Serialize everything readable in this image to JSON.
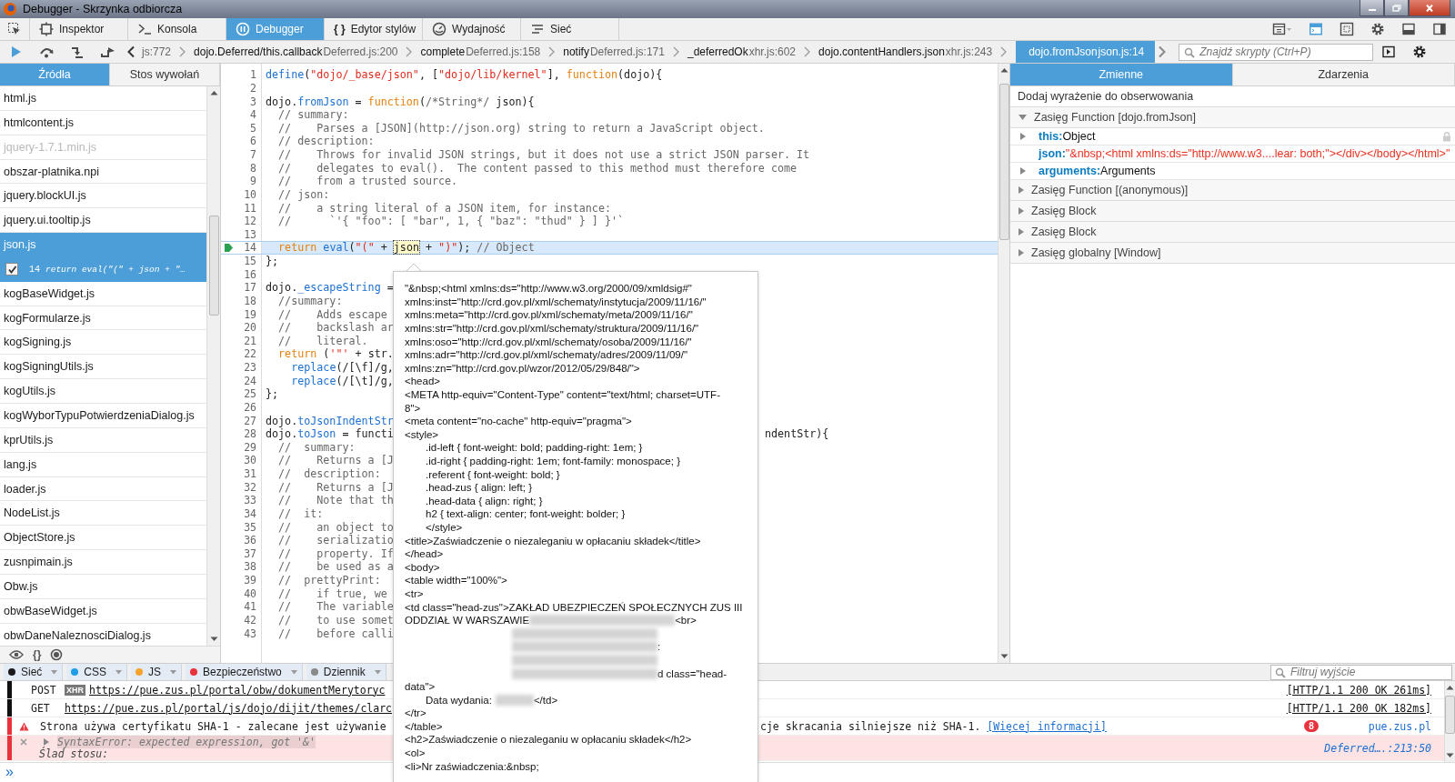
{
  "window": {
    "title": "Debugger - Skrzynka odbiorcza"
  },
  "toolbox_tabs": [
    {
      "label": "Inspektor",
      "kind": "inspector",
      "selected": false
    },
    {
      "label": "Konsola",
      "kind": "console",
      "selected": false
    },
    {
      "label": "Debugger",
      "kind": "pause",
      "selected": true
    },
    {
      "label": "Edytor stylów",
      "kind": "glyph",
      "glyph": "{ }",
      "selected": false
    },
    {
      "label": "Wydajność",
      "kind": "gauge",
      "selected": false
    },
    {
      "label": "Sieć",
      "kind": "network",
      "selected": false
    }
  ],
  "call_stack": [
    {
      "location": "js:772",
      "selected": false
    },
    {
      "function": "dojo.Deferred/this.callback",
      "location": "Deferred.js:200",
      "selected": false
    },
    {
      "function": "complete",
      "location": "Deferred.js:158",
      "selected": false
    },
    {
      "function": "notify",
      "location": "Deferred.js:171",
      "selected": false
    },
    {
      "function": "_deferredOk",
      "location": "xhr.js:602",
      "selected": false
    },
    {
      "function": "dojo.contentHandlers.json",
      "location": "xhr.js:243",
      "selected": false
    },
    {
      "function": "dojo.fromJson",
      "location": "json.js:14",
      "selected": true
    }
  ],
  "script_search": {
    "placeholder": "Znajdź skrypty (Ctrl+P)"
  },
  "sidebar": {
    "tabs": [
      {
        "label": "Źródła",
        "selected": true
      },
      {
        "label": "Stos wywołań",
        "selected": false
      }
    ],
    "sources": [
      {
        "name": "html.js",
        "selected": false,
        "disabled": false
      },
      {
        "name": "htmlcontent.js",
        "selected": false,
        "disabled": false
      },
      {
        "name": "jquery-1.7.1.min.js",
        "selected": false,
        "disabled": true
      },
      {
        "name": "obszar-platnika.npi",
        "selected": false,
        "disabled": false
      },
      {
        "name": "jquery.blockUI.js",
        "selected": false,
        "disabled": false
      },
      {
        "name": "jquery.ui.tooltip.js",
        "selected": false,
        "disabled": false
      },
      {
        "name": "json.js",
        "selected": true,
        "disabled": false,
        "breakpoints": [
          {
            "line": "14",
            "text": "return eval(\"(\" + json + \"…",
            "checked": true
          }
        ]
      },
      {
        "name": "kogBaseWidget.js",
        "selected": false,
        "disabled": false
      },
      {
        "name": "kogFormularze.js",
        "selected": false,
        "disabled": false
      },
      {
        "name": "kogSigning.js",
        "selected": false,
        "disabled": false
      },
      {
        "name": "kogSigningUtils.js",
        "selected": false,
        "disabled": false
      },
      {
        "name": "kogUtils.js",
        "selected": false,
        "disabled": false
      },
      {
        "name": "kogWyborTypuPotwierdzeniaDialog.js",
        "selected": false,
        "disabled": false
      },
      {
        "name": "kprUtils.js",
        "selected": false,
        "disabled": false
      },
      {
        "name": "lang.js",
        "selected": false,
        "disabled": false
      },
      {
        "name": "loader.js",
        "selected": false,
        "disabled": false
      },
      {
        "name": "NodeList.js",
        "selected": false,
        "disabled": false
      },
      {
        "name": "ObjectStore.js",
        "selected": false,
        "disabled": false
      },
      {
        "name": "zusnpimain.js",
        "selected": false,
        "disabled": false
      },
      {
        "name": "Obw.js",
        "selected": false,
        "disabled": false
      },
      {
        "name": "obwBaseWidget.js",
        "selected": false,
        "disabled": false
      },
      {
        "name": "obwDaneNaleznosciDialog.js",
        "selected": false,
        "disabled": false
      }
    ],
    "pretty_print_label": "{}"
  },
  "editor": {
    "lines": [
      {
        "n": "1",
        "text": "define(\"dojo/_base/json\", [\"dojo/lib/kernel\"], function(dojo){",
        "paused": false,
        "breakpoint": false
      },
      {
        "n": "2",
        "paused": false,
        "breakpoint": false
      },
      {
        "n": "3",
        "text": "dojo.fromJson = function(/*String*/ json){",
        "paused": false,
        "breakpoint": false
      },
      {
        "n": "4",
        "text": "  // summary:",
        "paused": false,
        "breakpoint": false
      },
      {
        "n": "5",
        "text": "  //    Parses a [JSON](http://json.org) string to return a JavaScript object.",
        "paused": false,
        "breakpoint": false
      },
      {
        "n": "6",
        "text": "  // description:",
        "paused": false,
        "breakpoint": false
      },
      {
        "n": "7",
        "text": "  //    Throws for invalid JSON strings, but it does not use a strict JSON parser. It",
        "paused": false,
        "breakpoint": false
      },
      {
        "n": "8",
        "text": "  //    delegates to eval().  The content passed to this method must therefore come",
        "paused": false,
        "breakpoint": false
      },
      {
        "n": "9",
        "text": "  //    from a trusted source.",
        "paused": false,
        "breakpoint": false
      },
      {
        "n": "10",
        "text": "  // json:",
        "paused": false,
        "breakpoint": false
      },
      {
        "n": "11",
        "text": "  //    a string literal of a JSON item, for instance:",
        "paused": false,
        "breakpoint": false
      },
      {
        "n": "12",
        "text": "  //      `'{ \"foo\": [ \"bar\", 1, { \"baz\": \"thud\" } ] }'`",
        "paused": false,
        "breakpoint": false
      },
      {
        "n": "13",
        "paused": false,
        "breakpoint": false
      },
      {
        "n": "14",
        "parts": [
          {
            "text": "  return eval(\"(\" + ",
            "hovered": false
          },
          {
            "text": "json",
            "hovered": true
          },
          {
            "text": " + \")\"); // Object",
            "hovered": false
          }
        ],
        "paused": true,
        "breakpoint": true
      },
      {
        "n": "15",
        "text": "};",
        "paused": false,
        "breakpoint": false
      },
      {
        "n": "16",
        "paused": false,
        "breakpoint": false
      },
      {
        "n": "17",
        "text": "dojo._escapeString =",
        "paused": false,
        "breakpoint": false
      },
      {
        "n": "18",
        "text": "  //summary:",
        "paused": false,
        "breakpoint": false
      },
      {
        "n": "19",
        "text": "  //    Adds escape",
        "paused": false,
        "breakpoint": false
      },
      {
        "n": "20",
        "text": "  //    backslash ar",
        "paused": false,
        "breakpoint": false
      },
      {
        "n": "21",
        "text": "  //    literal.",
        "paused": false,
        "breakpoint": false
      },
      {
        "n": "22",
        "text": "  return ('\"' + str.",
        "paused": false,
        "breakpoint": false
      },
      {
        "n": "23",
        "text": "    replace(/[\\f]/g,",
        "paused": false,
        "breakpoint": false
      },
      {
        "n": "24",
        "text": "    replace(/[\\t]/g,",
        "paused": false,
        "breakpoint": false
      },
      {
        "n": "25",
        "text": "};",
        "paused": false,
        "breakpoint": false
      },
      {
        "n": "26",
        "paused": false,
        "breakpoint": false
      },
      {
        "n": "27",
        "text": "dojo.toJsonIndentStr",
        "paused": false,
        "breakpoint": false
      },
      {
        "n": "28",
        "text": "dojo.toJson = functi",
        "after_popup": "ndentStr){",
        "paused": false,
        "breakpoint": false
      },
      {
        "n": "29",
        "text": "  //  summary:",
        "paused": false,
        "breakpoint": false
      },
      {
        "n": "30",
        "text": "  //    Returns a [J",
        "paused": false,
        "breakpoint": false
      },
      {
        "n": "31",
        "text": "  //  description:",
        "paused": false,
        "breakpoint": false
      },
      {
        "n": "32",
        "text": "  //    Returns a [J",
        "paused": false,
        "breakpoint": false
      },
      {
        "n": "33",
        "text": "  //    Note that th",
        "paused": false,
        "breakpoint": false
      },
      {
        "n": "34",
        "text": "  //  it:",
        "paused": false,
        "breakpoint": false
      },
      {
        "n": "35",
        "text": "  //    an object to",
        "paused": false,
        "breakpoint": false
      },
      {
        "n": "36",
        "text": "  //    serializatio",
        "paused": false,
        "breakpoint": false
      },
      {
        "n": "37",
        "text": "  //    property. If",
        "paused": false,
        "breakpoint": false
      },
      {
        "n": "38",
        "text": "  //    be used as a",
        "paused": false,
        "breakpoint": false
      },
      {
        "n": "39",
        "text": "  //  prettyPrint:",
        "paused": false,
        "breakpoint": false
      },
      {
        "n": "40",
        "text": "  //    if true, we",
        "paused": false,
        "breakpoint": false
      },
      {
        "n": "41",
        "text": "  //    The variable",
        "paused": false,
        "breakpoint": false
      },
      {
        "n": "42",
        "text": "  //    to use somet",
        "paused": false,
        "breakpoint": false
      },
      {
        "n": "43",
        "text": "  //    before calli",
        "paused": false,
        "breakpoint": false
      }
    ]
  },
  "popup": {
    "lines": [
      [
        {
          "kind": "text",
          "text": "\"&nbsp;<html xmlns:ds=\"http://www.w3.org/2000/09/xmldsig#\""
        }
      ],
      [
        {
          "kind": "text",
          "text": "xmlns:inst=\"http://crd.gov.pl/xml/schematy/instytucja/2009/11/16/\""
        }
      ],
      [
        {
          "kind": "text",
          "text": "xmlns:meta=\"http://crd.gov.pl/xml/schematy/meta/2009/11/16/\""
        }
      ],
      [
        {
          "kind": "text",
          "text": "xmlns:str=\"http://crd.gov.pl/xml/schematy/struktura/2009/11/16/\""
        }
      ],
      [
        {
          "kind": "text",
          "text": "xmlns:oso=\"http://crd.gov.pl/xml/schematy/osoba/2009/11/16/\""
        }
      ],
      [
        {
          "kind": "text",
          "text": "xmlns:adr=\"http://crd.gov.pl/xml/schematy/adres/2009/11/09/\""
        }
      ],
      [
        {
          "kind": "text",
          "text": "xmlns:zn=\"http://crd.gov.pl/wzor/2012/05/29/848/\">"
        }
      ],
      [
        {
          "kind": "text",
          "text": "<head>"
        }
      ],
      [
        {
          "kind": "text",
          "text": "<META http-equiv=\"Content-Type\" content=\"text/html; charset=UTF-"
        }
      ],
      [
        {
          "kind": "text",
          "text": "8\">"
        }
      ],
      [
        {
          "kind": "text",
          "text": "<meta content=\"no-cache\" http-equiv=\"pragma\">"
        }
      ],
      [
        {
          "kind": "text",
          "text": "<style>"
        }
      ],
      [
        {
          "kind": "indented",
          "text": ".id-left { font-weight: bold; padding-right: 1em; }"
        }
      ],
      [
        {
          "kind": "indented",
          "text": ".id-right { padding-right: 1em; font-family: monospace; }"
        }
      ],
      [
        {
          "kind": "indented",
          "text": ".referent { font-weight: bold; }"
        }
      ],
      [
        {
          "kind": "indented",
          "text": ".head-zus { align: left; }"
        }
      ],
      [
        {
          "kind": "indented",
          "text": ".head-data { align: right; }"
        }
      ],
      [
        {
          "kind": "indented",
          "text": "h2 { text-align: center; font-weight: bolder; }"
        }
      ],
      [
        {
          "kind": "indented",
          "text": "</style>"
        }
      ],
      [
        {
          "kind": "text",
          "text": "<title>Zaświadczenie o niezaleganiu w opłacaniu składek</title>"
        }
      ],
      [
        {
          "kind": "text",
          "text": "</head>"
        }
      ],
      [
        {
          "kind": "text",
          "text": "<body>"
        }
      ],
      [
        {
          "kind": "text",
          "text": "<table width=\"100%\">"
        }
      ],
      [
        {
          "kind": "text",
          "text": "<tr>"
        }
      ],
      [
        {
          "kind": "text",
          "text": "<td class=\"head-zus\">ZAKŁAD UBEZPIECZEŃ SPOŁECZNYCH ZUS III"
        }
      ],
      [
        {
          "kind": "text",
          "text": "ODDZIAŁ W WARSZAWIE"
        },
        {
          "kind": "blur"
        },
        {
          "kind": "text",
          "text": "<br>"
        }
      ],
      [
        {
          "kind": "blur"
        }
      ],
      [
        {
          "kind": "blur"
        },
        {
          "kind": "text",
          "text": ":"
        }
      ],
      [
        {
          "kind": "blur"
        }
      ],
      [
        {
          "kind": "blur"
        },
        {
          "kind": "text",
          "text": "d class=\"head-"
        }
      ],
      [
        {
          "kind": "text",
          "text": "data\">"
        }
      ],
      [
        {
          "kind": "indented",
          "text": "Data wydania:"
        },
        {
          "kind": "short_blur"
        },
        {
          "kind": "text",
          "text": "</td>"
        }
      ],
      [
        {
          "kind": "text",
          "text": "</tr>"
        }
      ],
      [
        {
          "kind": "text",
          "text": "</table>"
        }
      ],
      [
        {
          "kind": "text",
          "text": "<h2>Zaświadczenie o niezaleganiu w opłacaniu składek</h2>"
        }
      ],
      [
        {
          "kind": "text",
          "text": "<ol>"
        }
      ],
      [
        {
          "kind": "text",
          "text": "<li>Nr zaświadczenia:&nbsp;"
        }
      ]
    ]
  },
  "variables": {
    "tabs": [
      {
        "label": "Zmienne",
        "selected": true
      },
      {
        "label": "Zdarzenia",
        "selected": false
      }
    ],
    "watch_placeholder": "Dodaj wyrażenie do obserwowania",
    "scopes": [
      {
        "label": "Zasięg Function [dojo.fromJson]",
        "expanded": true,
        "variables": [
          {
            "name": "this:",
            "value": "Object",
            "kind": "object",
            "expandable": true,
            "locked": true
          },
          {
            "name": "json:",
            "value": "\"&nbsp;<html xmlns:ds=\"http://www.w3....lear: both;\"></div></body></html>\"",
            "kind": "string",
            "expandable": false,
            "locked": false
          },
          {
            "name": "arguments:",
            "value": "Arguments",
            "kind": "object",
            "expandable": true,
            "locked": false
          }
        ]
      },
      {
        "label": "Zasięg Function [(anonymous)]",
        "expanded": false
      },
      {
        "label": "Zasięg Block",
        "expanded": false
      },
      {
        "label": "Zasięg Block",
        "expanded": false
      },
      {
        "label": "Zasięg globalny [Window]",
        "expanded": false
      }
    ]
  },
  "console": {
    "filters": [
      {
        "label": "Sieć",
        "color": "#1a1a1a"
      },
      {
        "label": "CSS",
        "color": "#1f9ee8"
      },
      {
        "label": "JS",
        "color": "#f5a32c"
      },
      {
        "label": "Bezpieczeństwo",
        "color": "#e8323c"
      },
      {
        "label": "Dziennik",
        "color": "#8a8a8a"
      }
    ],
    "filter_placeholder": "Filtruj wyjście",
    "messages": [
      {
        "kind": "network",
        "method": "POST",
        "badge": "XHR",
        "url": "https://pue.zus.pl/portal/obw/dokumentMerytoryc",
        "status": "[HTTP/1.1 200 OK 261ms]"
      },
      {
        "kind": "network",
        "method": "GET",
        "url": "https://pue.zus.pl/portal/js/dojo/dijit/themes/clarc",
        "status": "[HTTP/1.1 200 OK 182ms]"
      },
      {
        "kind": "warning",
        "text": "Strona używa certyfikatu SHA-1 - zalecane jest używanie",
        "text_after_popup": "cje skracania silniejsze niż SHA-1.",
        "link": "[Więcej informacji]",
        "count": "8",
        "source": "pue.zus.pl"
      },
      {
        "kind": "error",
        "text": "SyntaxError: expected expression, got '&'",
        "detail": "Ślad stosu:",
        "source": "Deferred….:213:50",
        "expanded": false
      }
    ],
    "prompt": "»"
  }
}
